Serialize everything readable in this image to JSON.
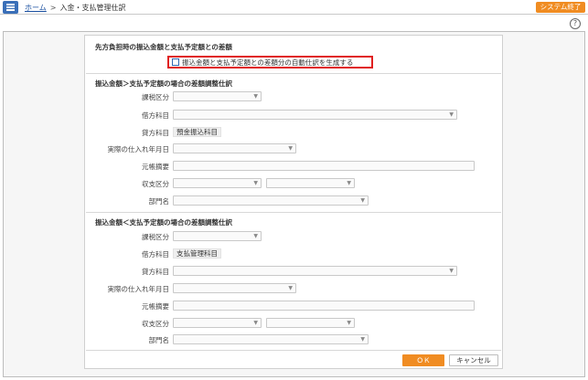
{
  "header": {
    "home_link": "ホーム",
    "separator": ">",
    "current_page": "入金・支払管理仕訳",
    "exit_button": "システム終了",
    "help": "?"
  },
  "diff_section": {
    "title": "先方負担時の振込金額と支払予定額との差額",
    "generate_checkbox": {
      "label": "振込金額と支払予定額との差額分の自動仕訳を生成する",
      "checked": false
    }
  },
  "section_greater": {
    "title": "振込金額＞支払予定額の場合の差額調整仕訳",
    "fields": {
      "tax_category": "課税区分",
      "debit_account": "借方科目",
      "credit_account": "貸方科目",
      "credit_account_value": "預金振込科目",
      "actual_purchase_date": "実際の仕入れ年月日",
      "ledger_summary": "元帳摘要",
      "income_expense_category": "収支区分",
      "department": "部門名"
    }
  },
  "section_less": {
    "title": "振込金額＜支払予定額の場合の差額調整仕訳",
    "fields": {
      "tax_category": "課税区分",
      "debit_account": "借方科目",
      "debit_account_value": "支払管理科目",
      "credit_account": "貸方科目",
      "actual_purchase_date": "実際の仕入れ年月日",
      "ledger_summary": "元帳摘要",
      "income_expense_category": "収支区分",
      "department": "部門名"
    }
  },
  "footer": {
    "ok_button": "ＯＫ",
    "cancel_button": "キャンセル"
  },
  "icons": {
    "menu": "hamburger-menu-icon",
    "help": "help-circle-icon",
    "dropdown": "chevron-down-icon"
  },
  "colors": {
    "accent_orange": "#f08c22",
    "menu_blue": "#3a6fb8",
    "highlight_red": "#e02020",
    "link_blue": "#1a4fa0"
  }
}
